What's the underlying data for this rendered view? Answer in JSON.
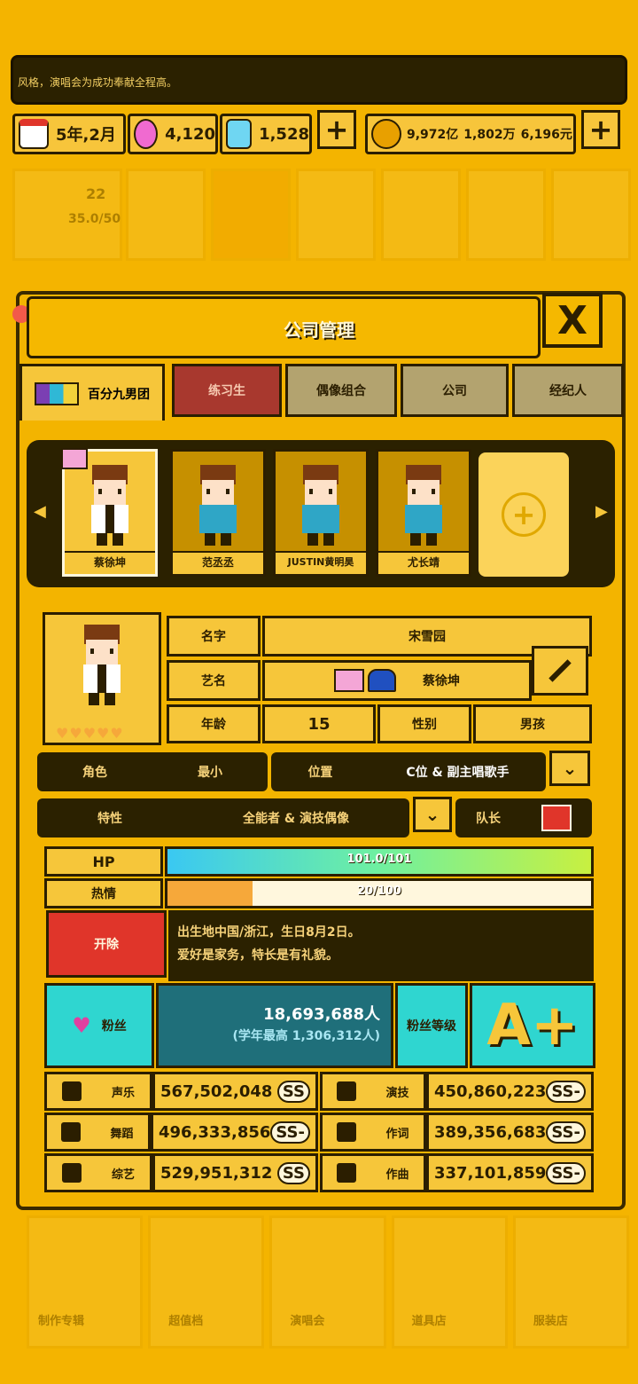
{
  "news": "风格，演唱会为成功奉献全程高。",
  "resources": {
    "date": "5年,2月",
    "gems": "4,120",
    "diamonds": "1,528",
    "money_yi": "9,972亿",
    "money_wan": "1,802万",
    "money_yuan": "6,196元",
    "plus": "+"
  },
  "background_tiles": {
    "row1": [
      "22",
      "35.0/50"
    ],
    "bottom": [
      "制作专辑",
      "超值档",
      "演唱会",
      "道具店",
      "服装店"
    ]
  },
  "panel": {
    "title": "公司管理",
    "close": "X",
    "tabs": [
      "百分九男团",
      "练习生",
      "偶像组合",
      "公司",
      "经纪人"
    ]
  },
  "members": [
    {
      "name": "蔡徐坤"
    },
    {
      "name": "范丞丞"
    },
    {
      "name": "JUSTIN黄明昊"
    },
    {
      "name": "尤长靖"
    }
  ],
  "profile": {
    "name_label": "名字",
    "name_value": "宋雪园",
    "alias_label": "艺名",
    "alias_value": "蔡徐坤",
    "age_label": "年龄",
    "age_value": "15",
    "gender_label": "性别",
    "gender_value": "男孩",
    "role_label": "角色",
    "role_value": "最小",
    "position_label": "位置",
    "position_value": "C位 & 副主唱歌手",
    "trait_label": "特性",
    "trait_value": "全能者 & 演技偶像",
    "leader_label": "队长",
    "hp_label": "HP",
    "hp_value": "101.0/101",
    "hp_fraction": 1.0,
    "passion_label": "热情",
    "passion_value": "20/100",
    "passion_fraction": 0.2,
    "debut_button": "开除",
    "bio_line1": "出生地中国/浙江，生日8月2日。",
    "bio_line2": "爱好是家务，特长是有礼貌。",
    "fans_label": "粉丝",
    "fans_value": "18,693,688人",
    "fans_sub": "(学年最高 1,306,312人)",
    "fan_level_label": "粉丝等级",
    "fan_level_value": "A+"
  },
  "stats": [
    {
      "label": "声乐",
      "value": "567,502,048",
      "grade": "SS"
    },
    {
      "label": "演技",
      "value": "450,860,223",
      "grade": "SS-"
    },
    {
      "label": "舞蹈",
      "value": "496,333,856",
      "grade": "SS-"
    },
    {
      "label": "作词",
      "value": "389,356,683",
      "grade": "SS-"
    },
    {
      "label": "综艺",
      "value": "529,951,312",
      "grade": "SS"
    },
    {
      "label": "作曲",
      "value": "337,101,859",
      "grade": "SS-"
    }
  ],
  "colors": {
    "bg": "#f4b400",
    "dark": "#2b2100",
    "teal": "#2fd6d0",
    "red": "#e0352a"
  }
}
